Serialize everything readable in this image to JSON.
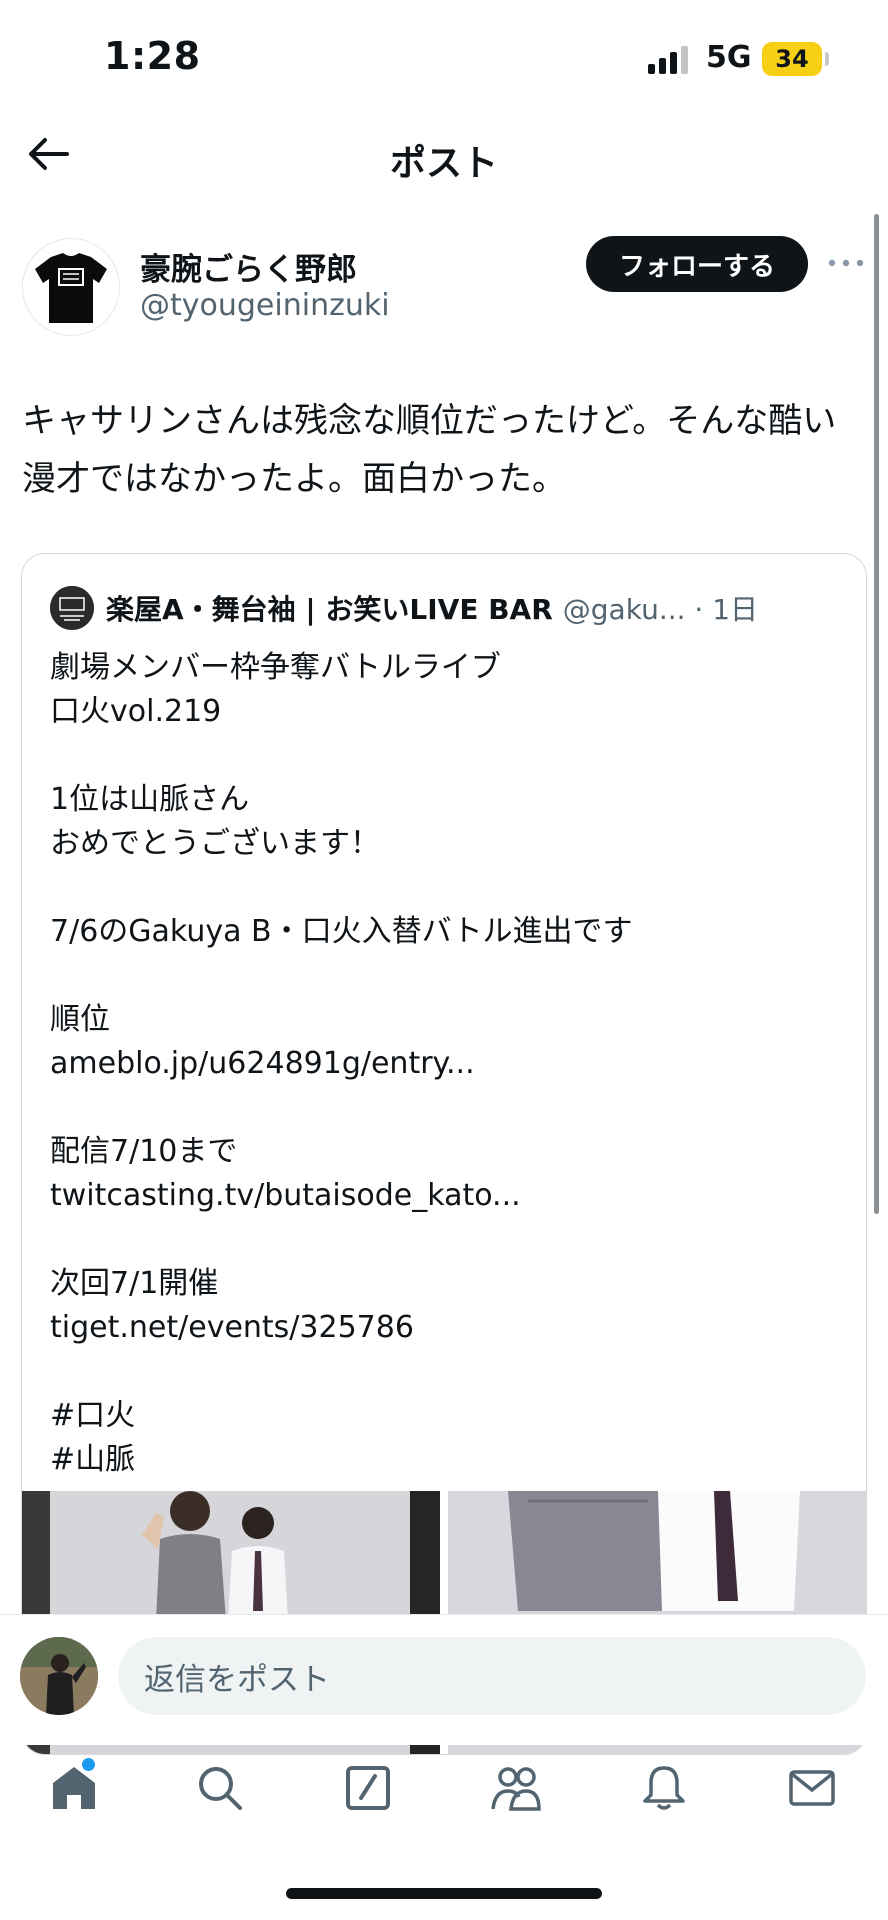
{
  "status_bar": {
    "time": "1:28",
    "network": "5G",
    "battery": "34",
    "battery_color": "#f7cf14"
  },
  "header": {
    "title": "ポスト",
    "back_icon": "arrow-left-icon"
  },
  "post": {
    "author": {
      "name": "豪腕ごらく野郎",
      "handle": "@tyougeininzuki",
      "avatar_icon": "black-tshirt-avatar"
    },
    "follow_label": "フォローする",
    "more_icon": "more-horizontal-icon",
    "text": "キャサリンさんは残念な順位だったけど。そんな酷い漫才ではなかったよ。面白かった。",
    "quote": {
      "author_name": "楽屋A・舞台袖 | お笑いLIVE BAR",
      "handle_time": "@gaku... · 1日",
      "text": "劇場メンバー枠争奪バトルライブ\n口火vol.219\n\n1位は山脈さん\nおめでとうございます！\n\n7/6のGakuya B・口火入替バトル進出です\n\n順位\nameblo.jp/u624891g/entry...\n\n配信7/10まで\ntwitcasting.tv/butaisode_kato...\n\n次回7/1開催\ntiget.net/events/325786\n\n#口火\n#山脈",
      "photos": [
        "stage-photo-duo-left",
        "stage-photo-duo-right"
      ]
    }
  },
  "reply": {
    "placeholder": "返信をポスト"
  },
  "nav": {
    "items": [
      "home-icon",
      "search-icon",
      "compose-icon",
      "communities-icon",
      "notifications-icon",
      "messages-icon"
    ]
  },
  "colors": {
    "text_primary": "#0f1419",
    "text_secondary": "#536471",
    "accent": "#1d9bf0",
    "border": "#cfd9de"
  }
}
